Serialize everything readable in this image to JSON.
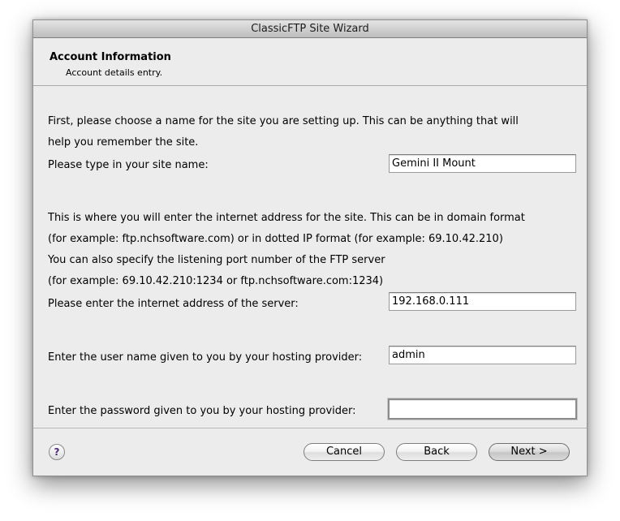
{
  "window": {
    "title": "ClassicFTP Site Wizard"
  },
  "header": {
    "title": "Account Information",
    "subtitle": "Account details entry."
  },
  "site_name": {
    "intro_line1": "First, please choose a name for the site you are setting up.  This can be anything that will",
    "intro_line2": "help you remember the site.",
    "label": "Please type in your site name:",
    "value": "Gemini II Mount"
  },
  "server": {
    "intro_line1": "This is where you will enter the internet address for the site. This can be in domain format",
    "intro_line2": "(for example: ftp.nchsoftware.com) or in dotted IP format (for example: 69.10.42.210)",
    "intro_line3": "You can also specify the listening port number of the FTP server",
    "intro_line4": "(for example: 69.10.42.210:1234 or ftp.nchsoftware.com:1234)",
    "label": "Please enter the internet address of the server:",
    "value": "192.168.0.111"
  },
  "username": {
    "label": "Enter the user name given to you by your hosting provider:",
    "value": "admin"
  },
  "password": {
    "label": "Enter the password given to you by your hosting provider:",
    "value": ""
  },
  "footer": {
    "help_label": "?",
    "cancel_label": "Cancel",
    "back_label": "Back",
    "next_label": "Next >"
  }
}
